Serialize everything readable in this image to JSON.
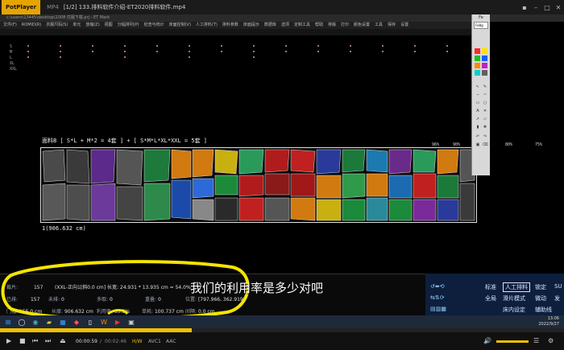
{
  "player": {
    "brand": "PotPlayer",
    "format": "MP4",
    "title": "[1/2] 133.排料软件介绍-ET2020排料软件.mp4"
  },
  "et_app": {
    "window_title": "c:\\users\\13445\\desktop\\1008 优服下载.prj - ET Mark",
    "menu": [
      "文件(F)",
      "ROMID(R)",
      "衣服尺码(S)",
      "单元",
      "放缩(Z)",
      "视图",
      "分幅排列(P)",
      "检查与统计",
      "床面控制(V)",
      "人工排料(T)",
      "排料参数",
      "床面提示",
      "数据库",
      "选项",
      "定制工具",
      "帮助",
      "排版",
      "打印",
      "颜色设置",
      "工具",
      "保存",
      "设置"
    ]
  },
  "sizes": [
    "S",
    "M",
    "L",
    "XL",
    "XXL"
  ],
  "marker": {
    "header": "面料B   [ S*L + M*2 = 4套 ] + [ S*M*L*XL*XXL = 5套 ]",
    "pct_labels": [
      "96%",
      "90%",
      "80%",
      "75%"
    ],
    "length_label": "1(906.632 cm)"
  },
  "palette": {
    "title": "Fe",
    "field": "Fe8g"
  },
  "status": {
    "cut_label": "裁片:",
    "cut_value": "157",
    "info": "(XXL-正向1[斜0.0 cm]  长宽: 24.931 * 13.935 cm = 54.0%",
    "placed_label": "已排:",
    "placed_value": "157",
    "unplaced_label": "未排:",
    "unplaced_value": "0",
    "extra_label": "多取:",
    "extra_value": "0",
    "overlap_label": "重叠:",
    "overlap_value": "0",
    "position_label": "位置:",
    "position_value": "[797.966, 362.919]",
    "width_label": "门幅:",
    "width_value": "155.0 cm",
    "length_label": "长度:",
    "length_value": "906.632 cm",
    "rate_label": "利用率:",
    "rate_value": "85.5%",
    "waste_label": "单耗:",
    "waste_value": "100.737 cm",
    "gap_label": "间隔:",
    "gap_value": "0.0 cm"
  },
  "commands": [
    "标准",
    "人工排料",
    "锁定",
    "SU",
    "全局",
    "滑片模式",
    "微动",
    "发",
    "床内设定",
    "辅助线"
  ],
  "subtitle": "我们的利用率是多少对吧",
  "taskbar_time": {
    "time": "13:06",
    "date": "2022/9/27"
  },
  "playback": {
    "current": "00:00:59",
    "total": "00:02:46",
    "tags": [
      "H/W",
      "AVC1",
      "AAC"
    ],
    "progress": 0.34
  },
  "colors": {
    "highlight_yellow": "#f5e400",
    "cursor_pink": "#ff3aa0",
    "seek_yellow": "#f0c000",
    "cmd_bg": "#0d1f3d"
  }
}
